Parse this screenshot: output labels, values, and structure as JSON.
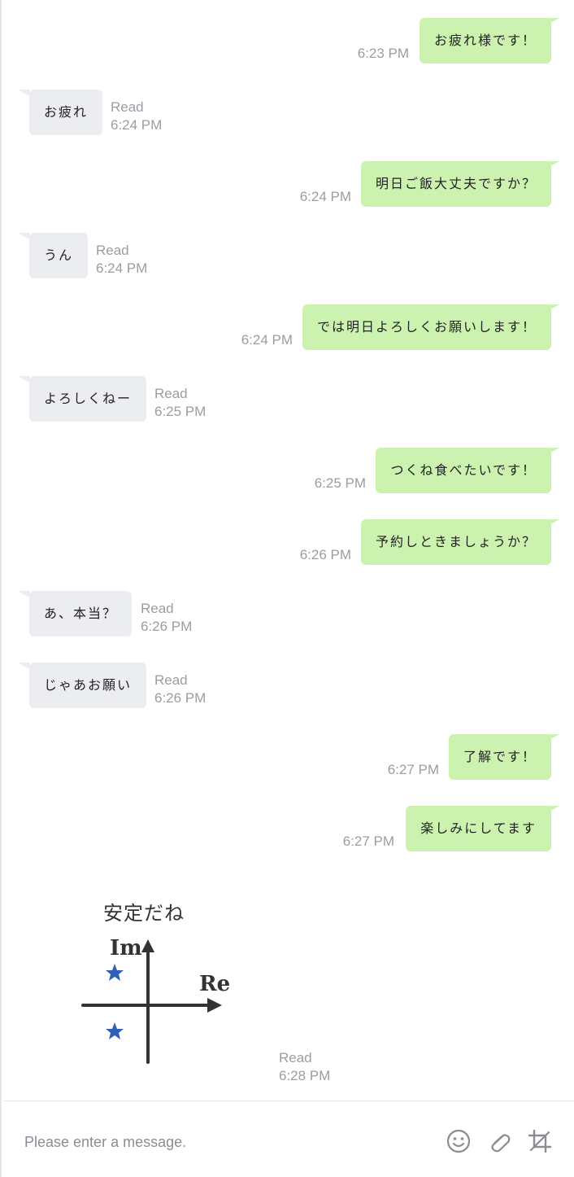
{
  "messages": [
    {
      "dir": "out",
      "text": "お疲れ様です！",
      "time": "6:23 PM"
    },
    {
      "dir": "in",
      "text": "お疲れ",
      "status": "Read",
      "time": "6:24 PM"
    },
    {
      "dir": "out",
      "text": "明日ご飯大丈夫ですか？",
      "time": "6:24 PM"
    },
    {
      "dir": "in",
      "text": "うん",
      "status": "Read",
      "time": "6:24 PM"
    },
    {
      "dir": "out",
      "text": "では明日よろしくお願いします！",
      "time": "6:24 PM"
    },
    {
      "dir": "in",
      "text": "よろしくねー",
      "status": "Read",
      "time": "6:25 PM"
    },
    {
      "dir": "out",
      "text": "つくね食べたいです！",
      "time": "6:25 PM"
    },
    {
      "dir": "out",
      "text": "予約しときましょうか？",
      "time": "6:26 PM"
    },
    {
      "dir": "in",
      "text": "あ、本当？",
      "status": "Read",
      "time": "6:26 PM"
    },
    {
      "dir": "in",
      "text": "じゃあお願い",
      "status": "Read",
      "time": "6:26 PM"
    },
    {
      "dir": "out",
      "text": "了解です！",
      "time": "6:27 PM"
    },
    {
      "dir": "out",
      "text": "楽しみにしてます",
      "time": "6:27 PM"
    }
  ],
  "sticker": {
    "caption": "安定だね",
    "y_label": "Im",
    "x_label": "Re",
    "status": "Read",
    "time": "6:28 PM"
  },
  "composer": {
    "placeholder": "Please enter a message.",
    "icons": [
      "smiley-icon",
      "paperclip-icon",
      "crop-icon"
    ]
  },
  "colors": {
    "outgoing_bubble": "#ccf2b0",
    "incoming_bubble": "#ecedf1",
    "meta_text": "#9b9da3",
    "star": "#2f5fb8"
  }
}
